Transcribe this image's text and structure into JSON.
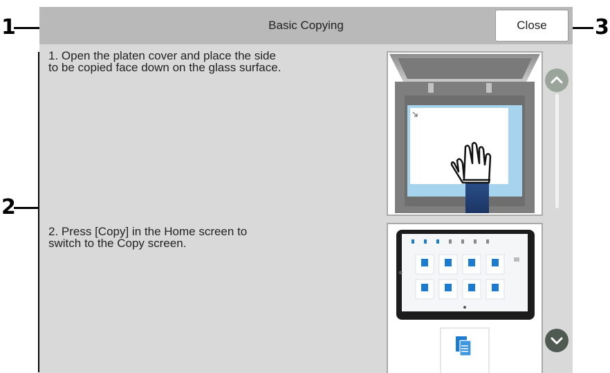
{
  "callouts": {
    "one": "1",
    "two": "2",
    "three": "3"
  },
  "header": {
    "title": "Basic Copying",
    "close_label": "Close"
  },
  "steps": [
    {
      "text": "1. Open the platen cover and place the side\nto be copied face down on the glass surface."
    },
    {
      "text": "2. Press [Copy] in the Home screen to\nswitch to the Copy screen."
    }
  ],
  "icons": {
    "scroll_up": "chevron-up-icon",
    "scroll_down": "chevron-down-icon"
  },
  "colors": {
    "panel": "#d9d9d9",
    "titlebar": "#b9b9b9",
    "scroll_button": "#9aa49a"
  }
}
